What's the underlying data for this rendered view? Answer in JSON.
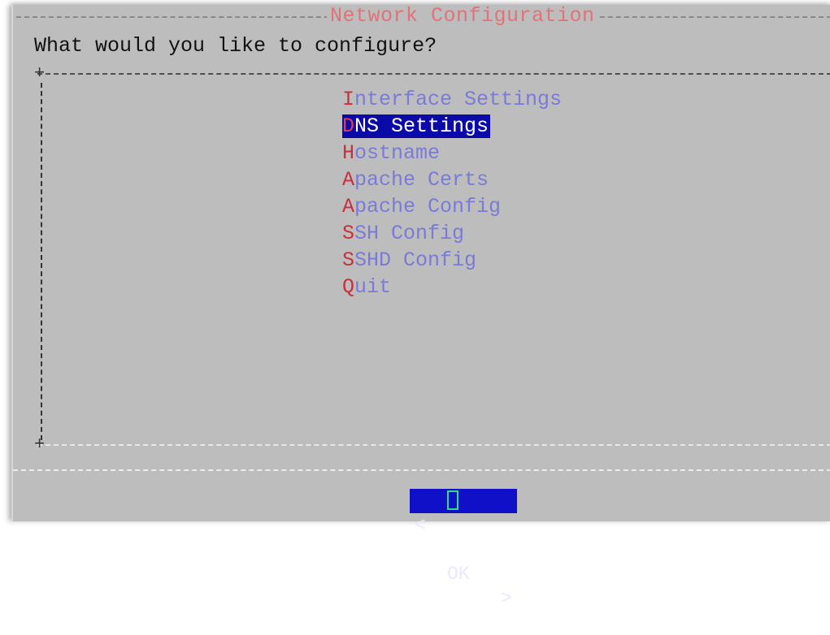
{
  "dialog": {
    "title": "Network Configuration",
    "prompt": "What would you like to configure?"
  },
  "frame": {
    "corner_glyph": "+"
  },
  "menu": {
    "items": [
      {
        "hot": "I",
        "rest": "nterface Settings",
        "selected": false
      },
      {
        "hot": "D",
        "rest": "NS Settings",
        "selected": true
      },
      {
        "hot": "H",
        "rest": "ostname",
        "selected": false
      },
      {
        "hot": "A",
        "rest": "pache Certs",
        "selected": false
      },
      {
        "hot": "A",
        "rest": "pache Config",
        "selected": false
      },
      {
        "hot": "S",
        "rest": "SH Config",
        "selected": false
      },
      {
        "hot": "S",
        "rest": "SHD Config",
        "selected": false
      },
      {
        "hot": "Q",
        "rest": "uit",
        "selected": false
      }
    ]
  },
  "buttons": {
    "ok": {
      "left_bracket": "<",
      "label": "OK",
      "right_bracket": ">"
    }
  },
  "colors": {
    "dialog_bg": "#bdbdbd",
    "title": "#e0737a",
    "hotkey": "#c8303a",
    "item_text": "#7a7ad8",
    "selection_bg": "#0b0aa8",
    "button_bg": "#1010c8"
  }
}
